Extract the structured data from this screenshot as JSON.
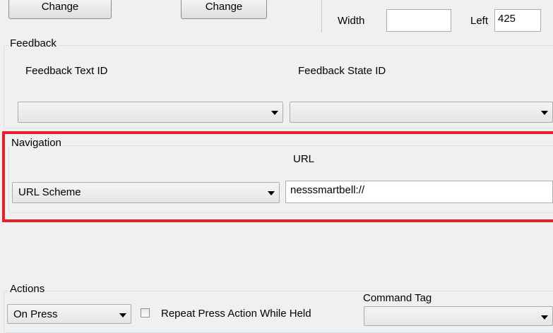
{
  "top": {
    "change_button_1": "Change",
    "change_button_2": "Change",
    "width_label": "Width",
    "width_value": "",
    "left_label": "Left",
    "left_value": "425"
  },
  "feedback": {
    "legend": "Feedback",
    "text_id_label": "Feedback Text ID",
    "state_id_label": "Feedback State ID",
    "text_id_value": "",
    "state_id_value": ""
  },
  "navigation": {
    "legend": "Navigation",
    "url_label": "URL",
    "scheme_value": "URL Scheme",
    "url_value": "nesssmartbell://"
  },
  "actions": {
    "legend": "Actions",
    "trigger_value": "On Press",
    "repeat_label": "Repeat Press Action While Held",
    "command_tag_label": "Command Tag",
    "command_tag_value": ""
  },
  "colors": {
    "highlight": "#e8202c",
    "background": "#f0f0f0"
  }
}
